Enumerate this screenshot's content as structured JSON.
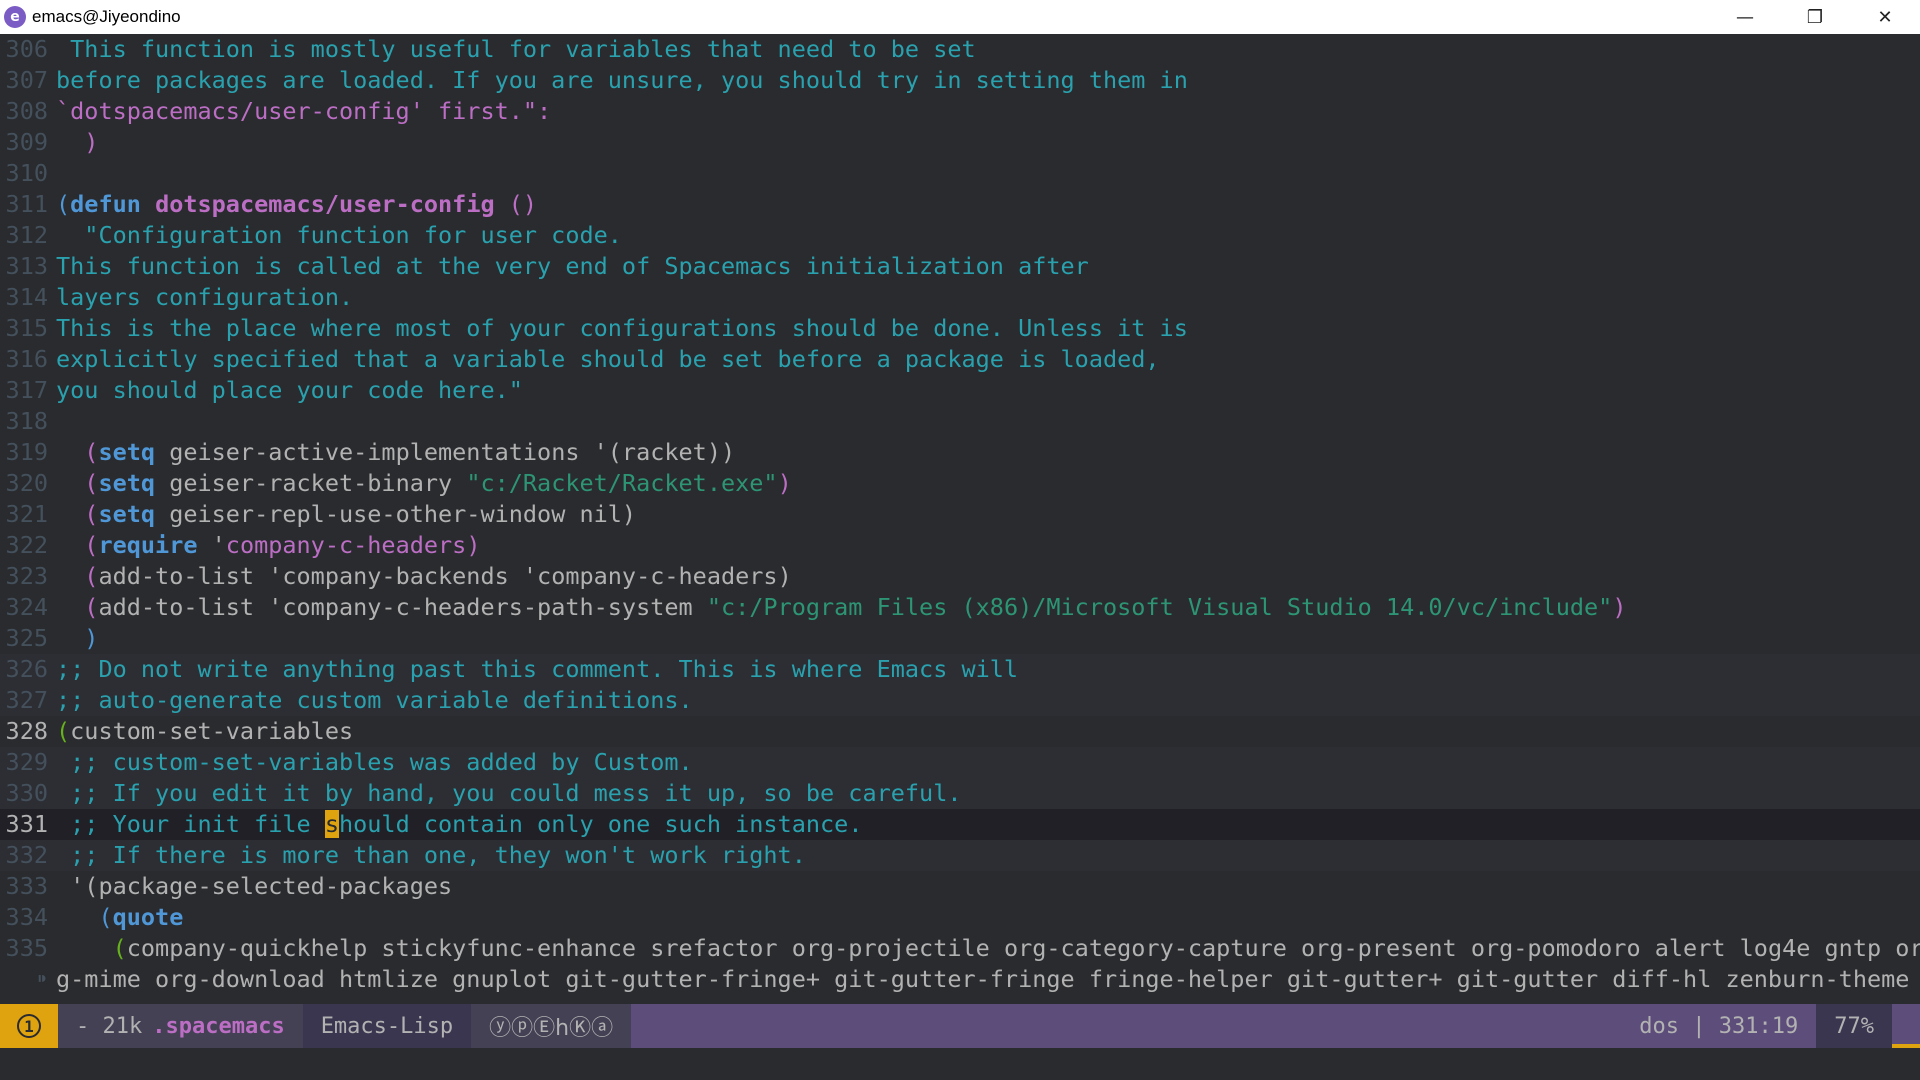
{
  "window": {
    "title": "emacs@Jiyeondino",
    "minimize": "—",
    "restore": "❐",
    "close": "✕"
  },
  "editor": {
    "l306": {
      "n": "306",
      "a": " This function is mostly useful for variables that need to be set"
    },
    "l307": {
      "n": "307",
      "a": "before packages are loaded. If you are unsure, you should try in setting them in"
    },
    "l308": {
      "n": "308",
      "a": "`dotspacemacs/user-config' first.\":"
    },
    "l309": {
      "n": "309",
      "a": "  )"
    },
    "l310": {
      "n": "310"
    },
    "l311": {
      "n": "311",
      "p": "(",
      "kw": "defun",
      "fn": "dotspacemacs/user-config",
      "rest": " ()"
    },
    "l312": {
      "n": "312",
      "a": "  \"Configuration function for user code."
    },
    "l313": {
      "n": "313",
      "a": "This function is called at the very end of Spacemacs initialization after"
    },
    "l314": {
      "n": "314",
      "a": "layers configuration."
    },
    "l315": {
      "n": "315",
      "a": "This is the place where most of your configurations should be done. Unless it is"
    },
    "l316": {
      "n": "316",
      "a": "explicitly specified that a variable should be set before a package is loaded,"
    },
    "l317": {
      "n": "317",
      "a": "you should place your code here.\""
    },
    "l318": {
      "n": "318"
    },
    "l319": {
      "n": "319",
      "kw": "setq",
      "b": " geiser-active-implementations '(racket))"
    },
    "l320": {
      "n": "320",
      "kw": "setq",
      "b": " geiser-racket-binary ",
      "s": "\"c:/Racket/Racket.exe\"",
      "c": ")"
    },
    "l321": {
      "n": "321",
      "kw": "setq",
      "b": " geiser-repl-use-other-window nil)"
    },
    "l322": {
      "n": "322",
      "kw": "require",
      "b": " '",
      "q": "company-c-headers",
      "c": ")"
    },
    "l323": {
      "n": "323",
      "b": "add-to-list 'company-backends 'company-c-headers)"
    },
    "l324": {
      "n": "324",
      "b": "add-to-list 'company-c-headers-path-system ",
      "s": "\"c:/Program Files (x86)/Microsoft Visual Studio 14.0/vc/include\"",
      "c": ")"
    },
    "l325": {
      "n": "325",
      "a": "  )"
    },
    "l326": {
      "n": "326",
      "a": ";; Do not write anything past this comment. This is where Emacs will"
    },
    "l327": {
      "n": "327",
      "a": ";; auto-generate custom variable definitions."
    },
    "l328": {
      "n": "328",
      "p": "(",
      "b": "custom-set-variables"
    },
    "l329": {
      "n": "329",
      "a": " ;; custom-set-variables was added by Custom."
    },
    "l330": {
      "n": "330",
      "a": " ;; If you edit it by hand, you could mess it up, so be careful."
    },
    "l331": {
      "n": "331",
      "a": " ;; Your init file ",
      "cur": "s",
      "b": "hould contain only one such instance."
    },
    "l332": {
      "n": "332",
      "a": " ;; If there is more than one, they won't work right."
    },
    "l333": {
      "n": "333",
      "a": " '(package-selected-packages"
    },
    "l334": {
      "n": "334",
      "p": "(",
      "kw": "quote"
    },
    "l335": {
      "n": "335",
      "p": "(",
      "b": "company-quickhelp stickyfunc-enhance srefactor org-projectile org-category-capture org-present org-pomodoro alert log4e gntp or"
    },
    "cont": "g-mime org-download htmlize gnuplot git-gutter-fringe+ git-gutter-fringe fringe-helper git-gutter+ git-gutter diff-hl zenburn-theme "
  },
  "modeline": {
    "window_num": "1",
    "buffer_info": "- 21k",
    "buffer_name": ".spacemacs",
    "major_mode": "Emacs-Lisp",
    "minor_modes": "ⓨⓟⒺhⓀⓐ",
    "eol": "dos",
    "sep": "|",
    "position": "331:19",
    "percent": "77%"
  },
  "colors": {
    "background": "#292b2e",
    "modeline": "#5d4d7a",
    "accent": "#e0a310",
    "keyword": "#4f97d7",
    "function": "#bc6ec5",
    "string": "#2d9574",
    "comment": "#2aa1ae"
  }
}
